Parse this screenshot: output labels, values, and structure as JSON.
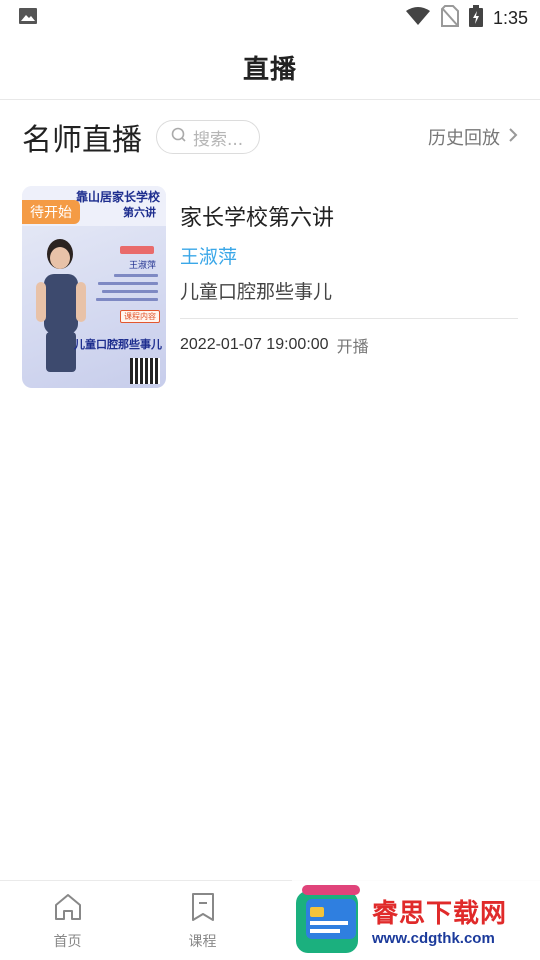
{
  "status_bar": {
    "time": "1:35",
    "icons": [
      "image-icon",
      "wifi-icon",
      "no-sim-icon",
      "battery-charging-icon"
    ]
  },
  "header": {
    "title": "直播"
  },
  "section": {
    "title": "名师直播",
    "search_placeholder": "搜索...",
    "history_label": "历史回放"
  },
  "courses": [
    {
      "badge": "待开始",
      "title": "家长学校第六讲",
      "teacher": "王淑萍",
      "subtitle": "儿童口腔那些事儿",
      "time": "2022-01-07 19:00:00",
      "status": "开播",
      "poster": {
        "school": "靠山居家长学校",
        "lecture": "第六讲",
        "teacher_name": "王淑萍",
        "content_tag": "课程内容",
        "topic": "儿童口腔那些事儿"
      }
    }
  ],
  "tabs": [
    {
      "label": "首页",
      "icon": "home-icon"
    },
    {
      "label": "课程",
      "icon": "bookmark-icon"
    }
  ],
  "watermark": {
    "name": "睿思下载网",
    "url": "www.cdgthk.com"
  },
  "colors": {
    "accent_blue": "#3aa7e8",
    "badge_orange": "#f49b45",
    "watermark_red": "#e02a2a",
    "watermark_blue": "#1b3a9b"
  }
}
